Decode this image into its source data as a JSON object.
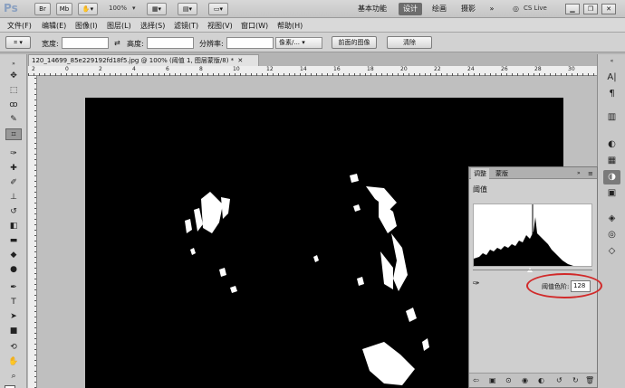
{
  "app": {
    "logo": "Ps",
    "mode_btn_1": "Br",
    "mode_btn_2": "Mb",
    "zoom": "100%",
    "workspaces": [
      "基本功能",
      "设计",
      "绘画",
      "摄影",
      "»"
    ],
    "active_workspace": "设计",
    "cs_live": "CS Live",
    "window_controls": [
      "minimize",
      "restore",
      "close"
    ]
  },
  "menu": [
    "文件(F)",
    "编辑(E)",
    "图像(I)",
    "图层(L)",
    "选择(S)",
    "滤镜(T)",
    "视图(V)",
    "窗口(W)",
    "帮助(H)"
  ],
  "options": {
    "width_label": "宽度:",
    "height_label": "高度:",
    "resolution_label": "分辨率:",
    "unit": "像素/...",
    "front_image_button": "前面的图像",
    "clear_button": "清除"
  },
  "document": {
    "tab_title": "120_14699_85e229192fd18f5.jpg @ 100% (阈值 1, 图层蒙版/8) *",
    "ruler_numbers_top": [
      "2",
      "0",
      "2",
      "4",
      "6",
      "8",
      "10",
      "12",
      "14",
      "16",
      "18",
      "20",
      "22",
      "24",
      "26",
      "28",
      "30"
    ]
  },
  "panel": {
    "tabs": [
      "调整",
      "蒙版"
    ],
    "title": "阈值",
    "threshold_label": "阈值色阶:",
    "threshold_value": "128"
  },
  "colors": {
    "highlight_circle": "#d12a2a"
  }
}
